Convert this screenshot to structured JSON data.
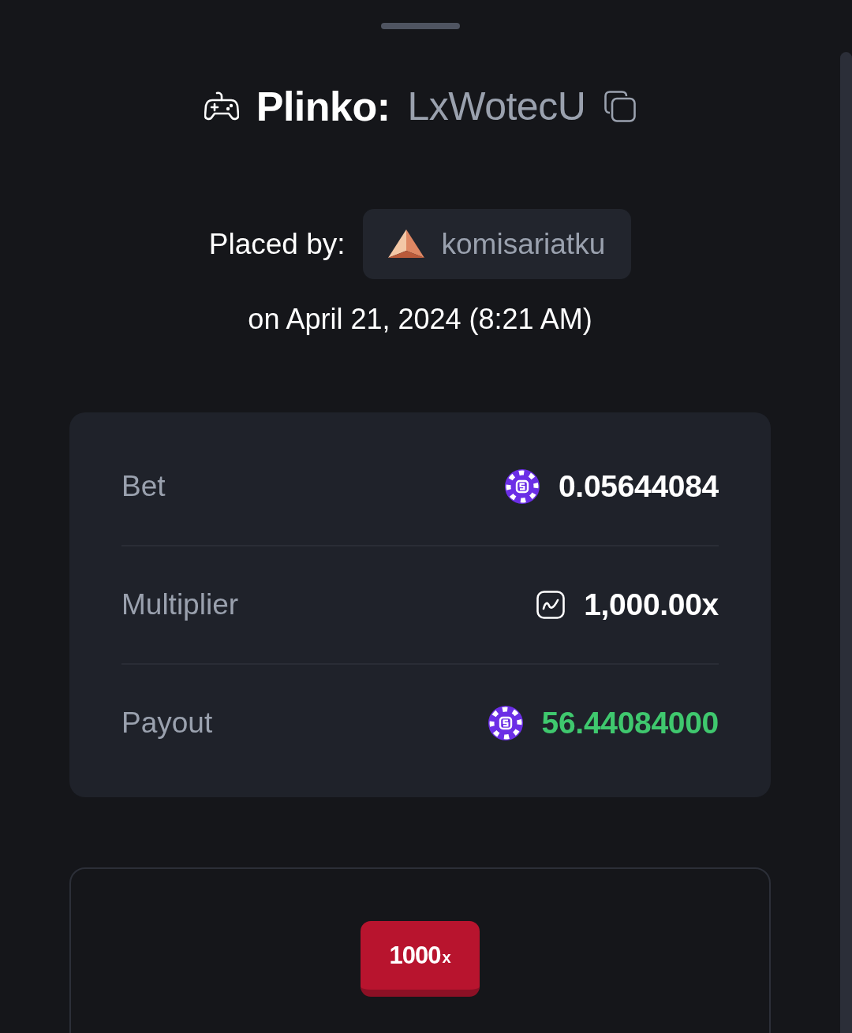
{
  "header": {
    "title": "Plinko:",
    "bet_id": "LxWotecU"
  },
  "placed_by": {
    "label": "Placed by:",
    "username": "komisariatku",
    "date": "on April 21, 2024 (8:21 AM)"
  },
  "details": [
    {
      "kind": "amount",
      "label": "Bet",
      "value": "0.05644084"
    },
    {
      "kind": "multiplier",
      "label": "Multiplier",
      "value": "1,000.00x"
    },
    {
      "kind": "payout",
      "label": "Payout",
      "value": "56.44084000"
    }
  ],
  "board": {
    "buckets": [
      {
        "value": "1000",
        "suffix": "x"
      }
    ]
  }
}
